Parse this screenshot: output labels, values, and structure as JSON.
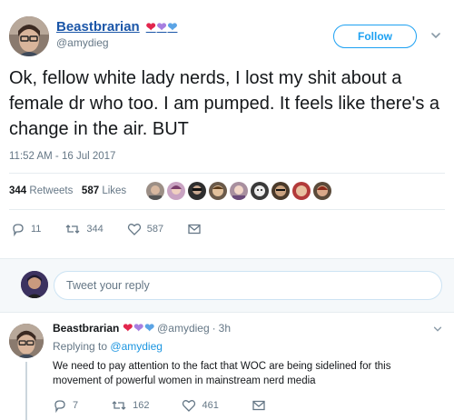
{
  "tweet": {
    "author_name": "Beastbrarian",
    "author_handle": "@amydieg",
    "name_hearts": [
      "❤",
      "💜",
      "💙"
    ],
    "follow_label": "Follow",
    "text": "Ok, fellow white lady nerds, I lost my shit about a female dr who too. I am pumped. It feels like there's a change in the air. BUT",
    "timestamp": "11:52 AM - 16 Jul 2017",
    "retweets_count": "344",
    "retweets_label": "Retweets",
    "likes_count": "587",
    "likes_label": "Likes",
    "actions": {
      "reply_count": "11",
      "retweet_count": "344",
      "like_count": "587"
    },
    "icons": [
      "reply-icon",
      "retweet-icon",
      "like-icon",
      "message-icon",
      "caret-down-icon"
    ]
  },
  "reply_box": {
    "placeholder": "Tweet your reply"
  },
  "reply": {
    "author_name": "Beastbrarian",
    "author_handle": "@amydieg",
    "separator": "·",
    "time": "3h",
    "replying_prefix": "Replying to",
    "replying_to": "@amydieg",
    "text": "We need to pay attention to the fact that WOC are being sidelined for this movement of powerful women in mainstream nerd media",
    "actions": {
      "reply_count": "7",
      "retweet_count": "162",
      "like_count": "461"
    }
  },
  "colors": {
    "link_blue": "#1b56a8",
    "twitter_blue": "#1da1f2",
    "muted": "#657786",
    "divider": "#e6ecf0"
  }
}
